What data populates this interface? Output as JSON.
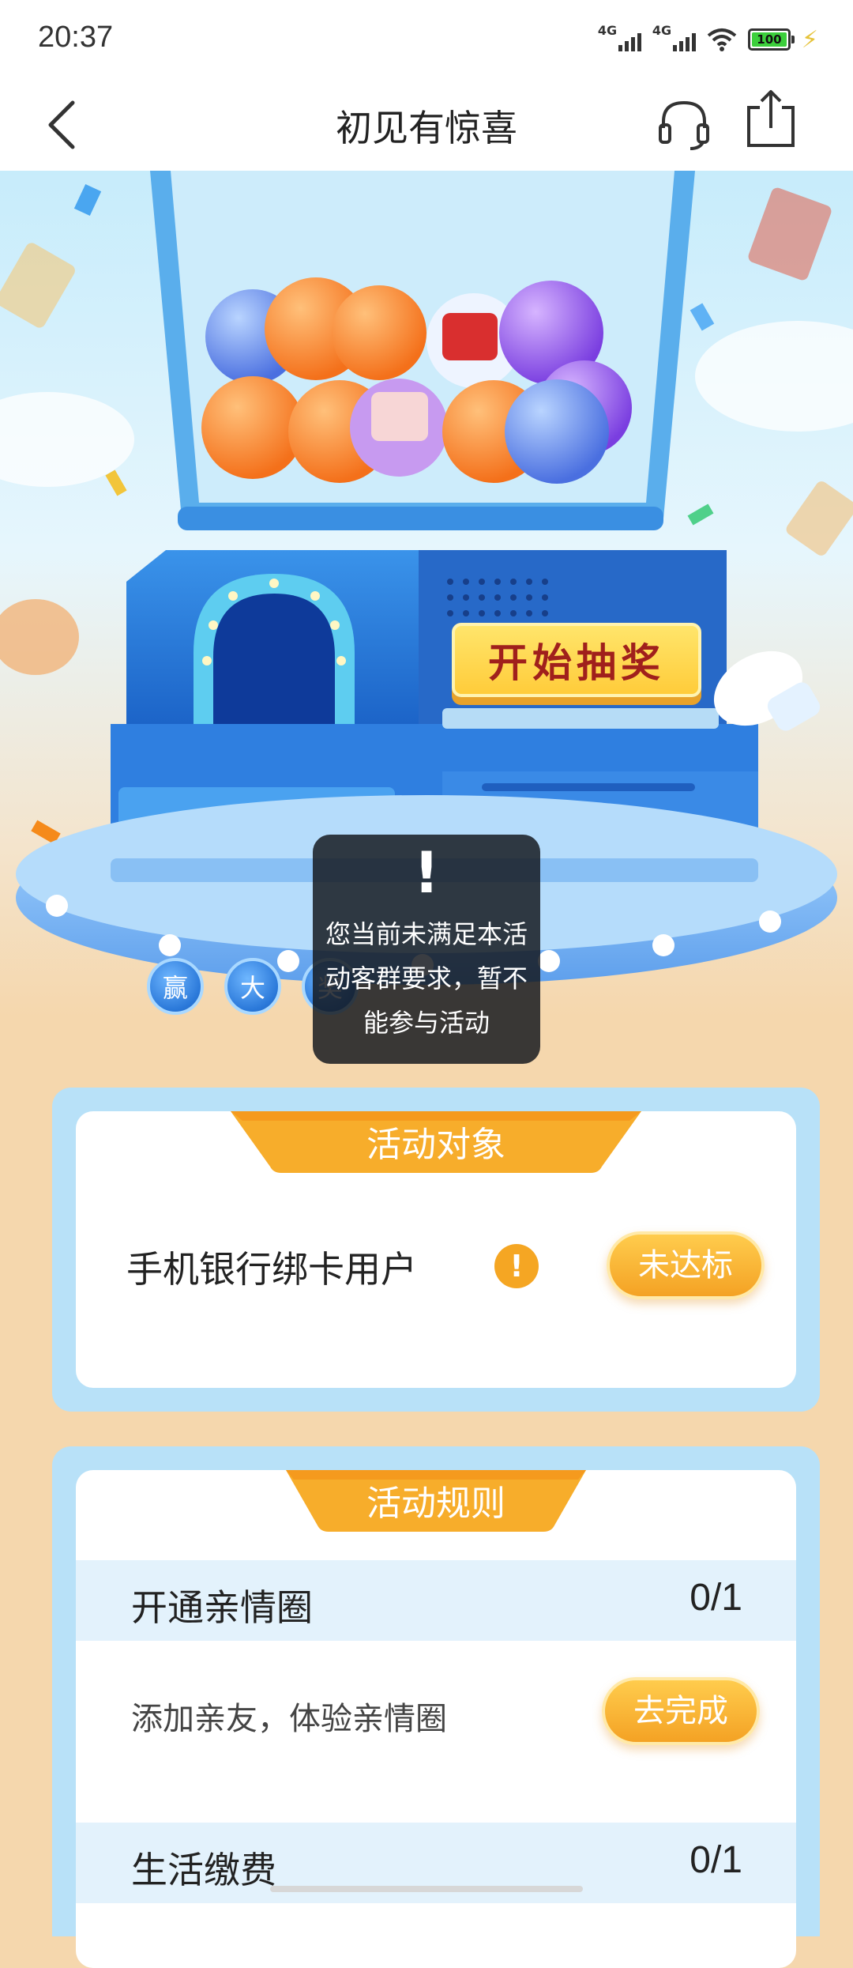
{
  "status_bar": {
    "time": "20:37",
    "network_1": "4G",
    "network_2": "4G",
    "battery": "100"
  },
  "nav": {
    "title": "初见有惊喜",
    "back_icon": "chevron-left-icon",
    "support_icon": "headset-icon",
    "share_icon": "share-icon"
  },
  "hero": {
    "start_button": "开始抽奖",
    "coins": [
      "赢",
      "大",
      "奖"
    ]
  },
  "toast": {
    "icon": "!",
    "message": "您当前未满足本活动客群要求，暂不能参与活动"
  },
  "target_card": {
    "title": "活动对象",
    "user_type": "手机银行绑卡用户",
    "status_button": "未达标"
  },
  "rules_card": {
    "title": "活动规则",
    "rules": [
      {
        "name": "开通亲情圈",
        "progress": "0/1",
        "desc": "添加亲友，体验亲情圈",
        "action": "去完成"
      },
      {
        "name": "生活缴费",
        "progress": "0/1"
      }
    ]
  },
  "colors": {
    "accent_orange": "#f4a224",
    "card_blue": "#b8e1f8",
    "page_bg": "#f5d7ad"
  }
}
